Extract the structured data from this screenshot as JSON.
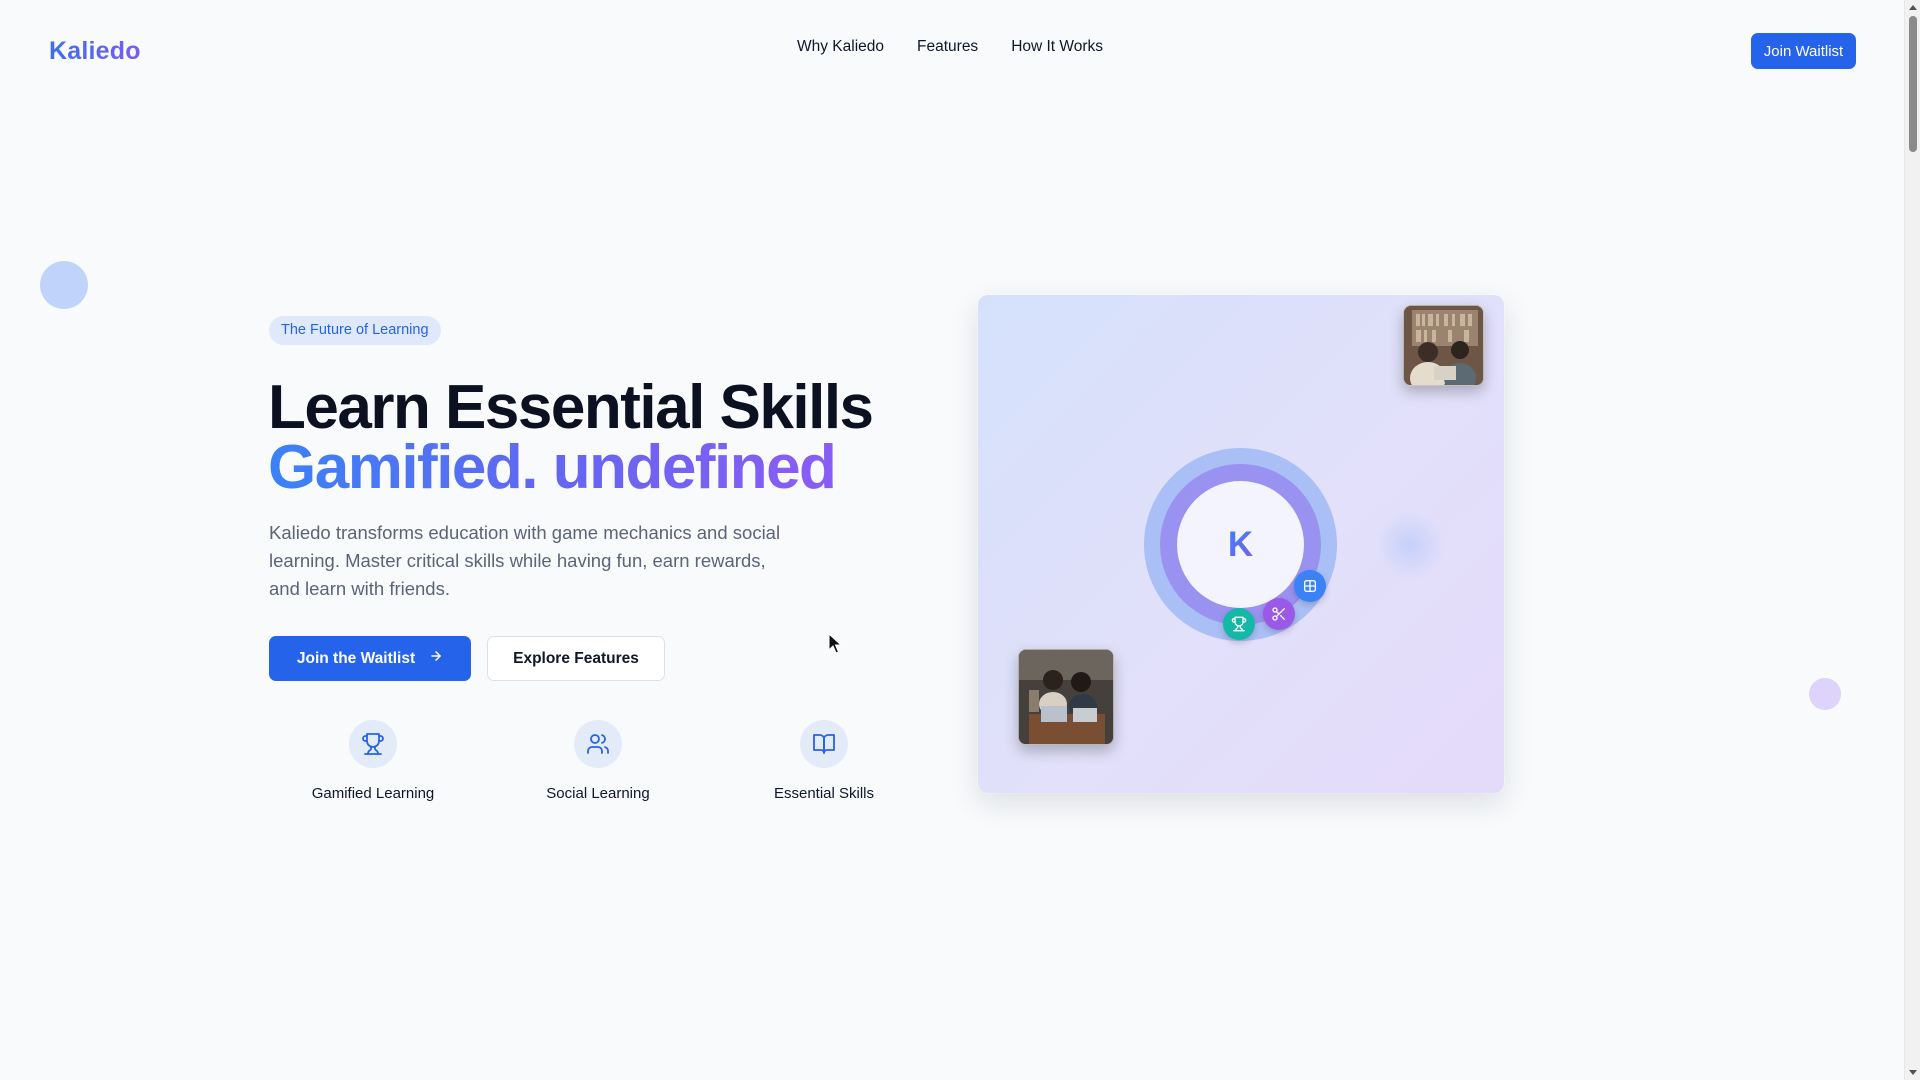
{
  "header": {
    "logo": "Kaliedo",
    "nav": [
      "Why Kaliedo",
      "Features",
      "How It Works"
    ],
    "cta": "Join Waitlist"
  },
  "hero": {
    "badge": "The Future of Learning",
    "headline_line1": "Learn Essential Skills",
    "headline_line2": "Gamified. undefined",
    "description": "Kaliedo transforms education with game mechanics and social learning. Master critical skills while having fun, earn rewards, and learn with friends.",
    "primary_button": "Join the Waitlist",
    "secondary_button": "Explore Features",
    "features": [
      {
        "label": "Gamified Learning",
        "icon": "trophy-icon"
      },
      {
        "label": "Social Learning",
        "icon": "users-icon"
      },
      {
        "label": "Essential Skills",
        "icon": "book-open-icon"
      }
    ]
  },
  "visual": {
    "center_letter": "K",
    "orbs": [
      "puzzle-icon",
      "share-icon",
      "trophy-icon"
    ]
  },
  "colors": {
    "primary": "#2563eb",
    "gradient_start": "#3b82f6",
    "gradient_end": "#8b5cf6",
    "background": "#f8fafc"
  }
}
